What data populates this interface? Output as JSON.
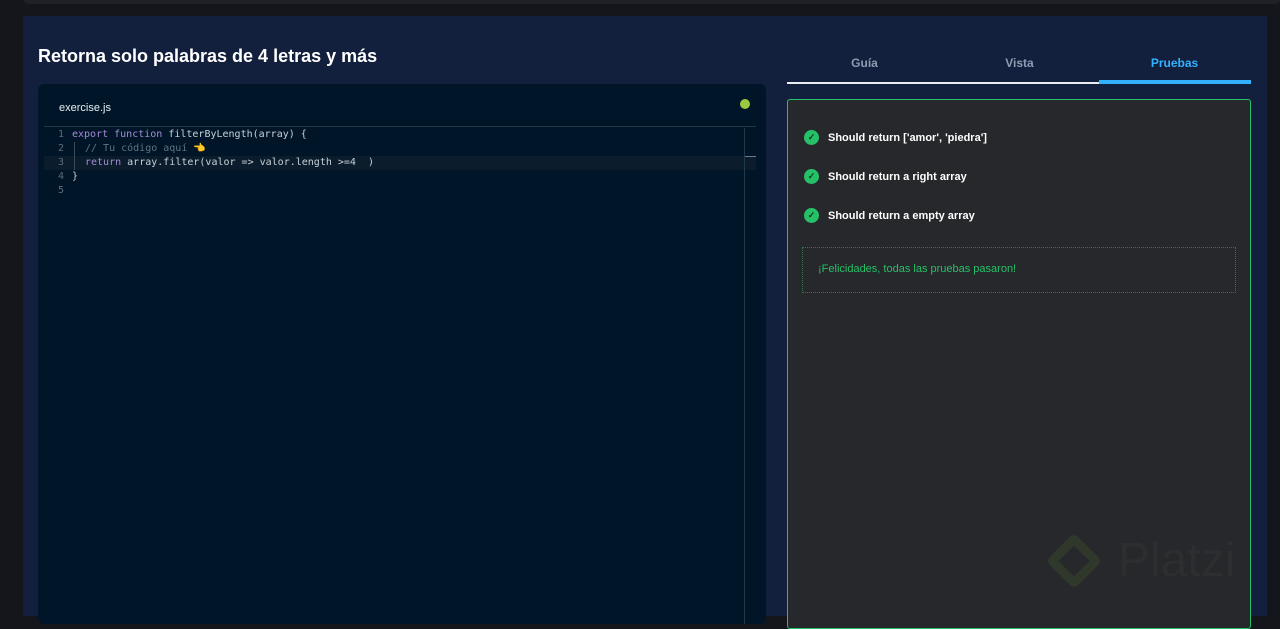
{
  "title": "Retorna solo palabras de 4 letras y más",
  "editor": {
    "filename": "exercise.js",
    "status_color": "#98ca3f",
    "lines": [
      {
        "n": "1",
        "parts": [
          [
            "kw",
            "export function "
          ],
          [
            "tx",
            "filterByLength(array) {"
          ]
        ]
      },
      {
        "n": "2",
        "parts": [
          [
            "cm",
            "// Tu código aquí 👈"
          ]
        ]
      },
      {
        "n": "3",
        "parts": [
          [
            "kw",
            "return "
          ],
          [
            "tx",
            "array.filter(valor => valor.length >=4  )"
          ]
        ]
      },
      {
        "n": "4",
        "parts": [
          [
            "tx",
            "}"
          ]
        ]
      },
      {
        "n": "5",
        "parts": []
      }
    ]
  },
  "tabs": [
    {
      "label": "Guía"
    },
    {
      "label": "Vista"
    },
    {
      "label": "Pruebas",
      "active": true
    }
  ],
  "tests": [
    {
      "label": "Should return ['amor', 'piedra']",
      "status": "passed"
    },
    {
      "label": "Should return a right array",
      "status": "passed"
    },
    {
      "label": "Should return a empty array",
      "status": "passed"
    }
  ],
  "success_message": "¡Felicidades, todas las pruebas pasaron!",
  "watermark": "Platzi",
  "colors": {
    "accent": "#33b1ff",
    "success": "#25c068"
  }
}
